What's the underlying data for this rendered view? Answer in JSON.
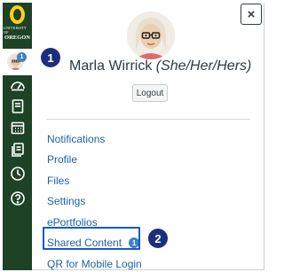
{
  "logo": {
    "line1": "UNIVERSITY OF",
    "line2": "OREGON"
  },
  "nav": {
    "account_badge": "1",
    "icons": [
      "dashboard-icon",
      "courses-icon",
      "calendar-icon",
      "inbox-icon",
      "history-icon",
      "help-icon"
    ]
  },
  "tray": {
    "close_label": "×",
    "user_name": "Marla Wirrick",
    "pronouns": "(She/Her/Hers)",
    "logout_label": "Logout",
    "menu": [
      {
        "label": "Notifications"
      },
      {
        "label": "Profile"
      },
      {
        "label": "Files"
      },
      {
        "label": "Settings"
      },
      {
        "label": "ePortfolios"
      },
      {
        "label": "Shared Content",
        "count": "1"
      },
      {
        "label": "QR for Mobile Login"
      }
    ]
  },
  "callouts": {
    "first": "1",
    "second": "2"
  },
  "colors": {
    "nav_background": "#1e4226",
    "oregon_yellow": "#fcd116",
    "link": "#1f61a8",
    "badge": "#3b82c4",
    "callout": "#1c2f7c",
    "highlight_border": "#1759c9"
  }
}
